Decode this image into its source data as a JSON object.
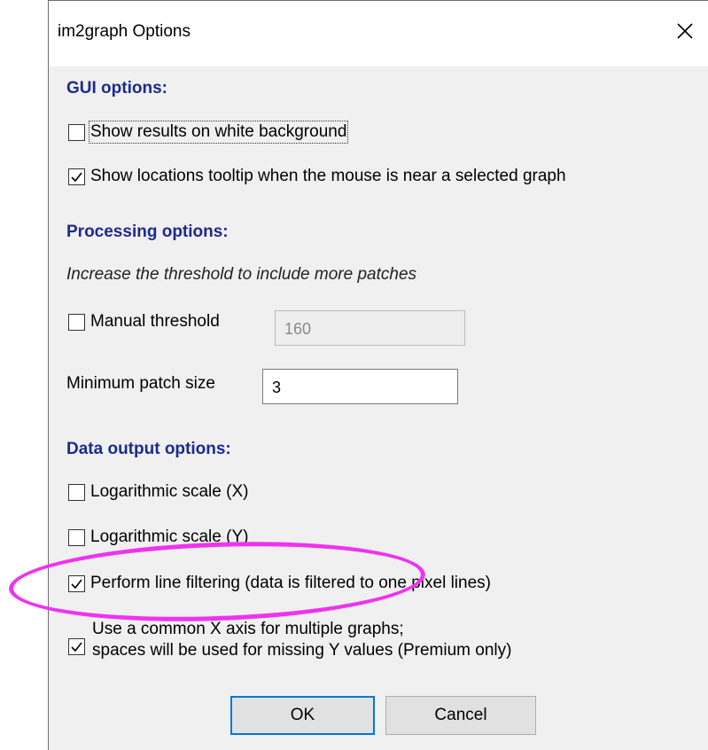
{
  "window": {
    "title": "im2graph Options",
    "close_icon": "close-icon"
  },
  "gui_options": {
    "heading": "GUI options:",
    "white_background": {
      "label": "Show results on white background",
      "checked": false
    },
    "tooltip": {
      "label": "Show locations tooltip when the mouse is near a selected graph",
      "checked": true
    }
  },
  "processing_options": {
    "heading": "Processing options:",
    "hint": "Increase the threshold to include more patches",
    "manual_threshold": {
      "label": "Manual threshold",
      "checked": false,
      "value": "160"
    },
    "min_patch": {
      "label": "Minimum patch size",
      "value": "3"
    }
  },
  "data_output_options": {
    "heading": "Data output options:",
    "log_x": {
      "label": "Logarithmic scale (X)",
      "checked": false
    },
    "log_y": {
      "label": "Logarithmic scale (Y)",
      "checked": false
    },
    "line_filtering": {
      "label": "Perform line filtering (data is filtered to one pixel lines)",
      "checked": true
    },
    "common_x": {
      "label_line1": "Use a common X axis for multiple graphs;",
      "label_line2": "spaces will be used for missing Y values (Premium only)",
      "checked": true
    }
  },
  "buttons": {
    "ok": "OK",
    "cancel": "Cancel"
  },
  "colors": {
    "heading": "#1c2b8c",
    "annotation": "#ee33ee",
    "focus": "#0078d7"
  }
}
